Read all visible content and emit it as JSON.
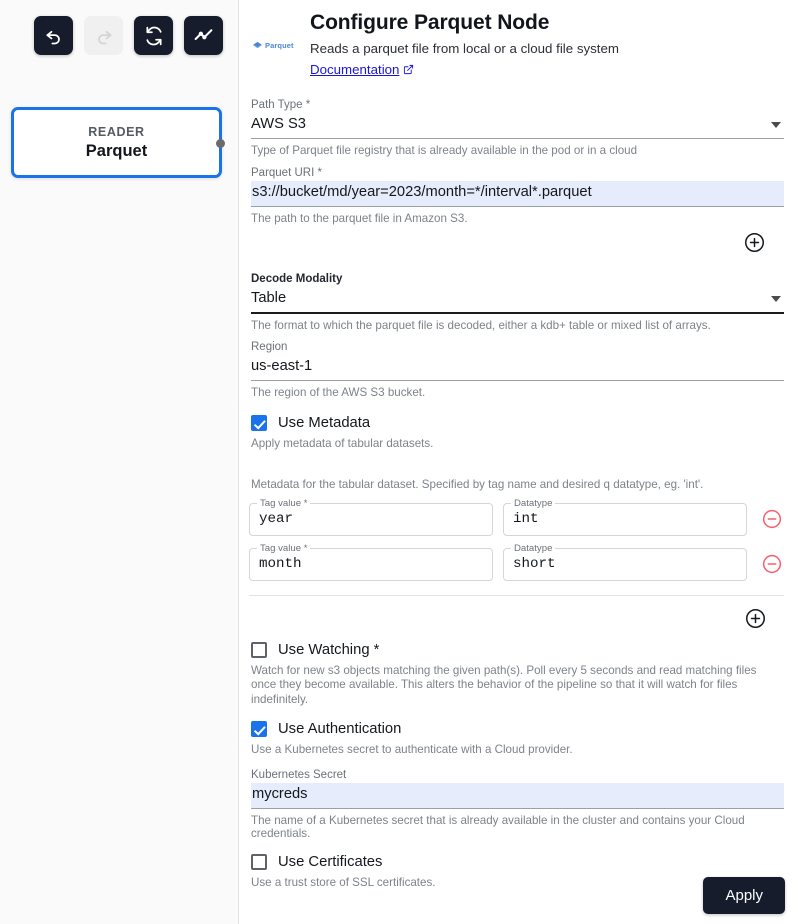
{
  "toolbar": {
    "buttons": [
      {
        "name": "undo",
        "label": "Undo",
        "icon": "undo-icon",
        "enabled": true
      },
      {
        "name": "redo",
        "label": "Redo",
        "icon": "redo-icon",
        "enabled": false
      },
      {
        "name": "refresh",
        "label": "Refresh",
        "icon": "sync-icon",
        "enabled": true
      },
      {
        "name": "activity",
        "label": "Activity",
        "icon": "line-chart-icon",
        "enabled": true
      }
    ]
  },
  "canvas": {
    "node": {
      "kind": "READER",
      "title": "Parquet"
    }
  },
  "header": {
    "logo_text": "Parquet",
    "logo_icon": "parquet-diamond-icon",
    "title": "Configure Parquet Node",
    "description": "Reads a parquet file from local or a cloud file system",
    "link_label": "Documentation",
    "link_icon": "external-link-icon"
  },
  "form": {
    "path_type": {
      "label": "Path Type *",
      "value": "AWS S3",
      "help": "Type of Parquet file registry that is already available in the pod or in a cloud"
    },
    "parquet_uri": {
      "label": "Parquet URI *",
      "value": "s3://bucket/md/year=2023/month=*/interval*.parquet",
      "help": "The path to the parquet file in Amazon S3."
    },
    "add_uri_button": {
      "icon": "plus-circle-icon",
      "label": "Add path"
    },
    "decode_modality": {
      "label": "Decode Modality",
      "value": "Table",
      "help": "The format to which the parquet file is decoded, either a kdb+ table or mixed list of arrays."
    },
    "region": {
      "label": "Region",
      "value": "us-east-1",
      "help": "The region of the AWS S3 bucket."
    },
    "use_metadata": {
      "label": "Use Metadata",
      "checked": true,
      "help": "Apply metadata of tabular datasets."
    },
    "metadata_note": "Metadata for the tabular dataset. Specified by tag name and desired q datatype, eg. 'int'.",
    "metadata_rows": [
      {
        "tag_label": "Tag value *",
        "tag_value": "year",
        "datatype_label": "Datatype",
        "datatype_value": "int",
        "remove_icon": "minus-circle-icon"
      },
      {
        "tag_label": "Tag value *",
        "tag_value": "month",
        "datatype_label": "Datatype",
        "datatype_value": "short",
        "remove_icon": "minus-circle-icon"
      }
    ],
    "add_metadata_button": {
      "icon": "plus-circle-icon",
      "label": "Add metadata row"
    },
    "use_watching": {
      "label": "Use Watching *",
      "checked": false,
      "help": "Watch for new s3 objects matching the given path(s). Poll every 5 seconds and read matching files once they become available. This alters the behavior of the pipeline so that it will watch for files indefinitely."
    },
    "use_authentication": {
      "label": "Use Authentication",
      "checked": true,
      "help": "Use a Kubernetes secret to authenticate with a Cloud provider."
    },
    "kubernetes_secret": {
      "label": "Kubernetes Secret",
      "value": "mycreds",
      "help": "The name of a Kubernetes secret that is already available in the cluster and contains your Cloud credentials."
    },
    "use_certificates": {
      "label": "Use Certificates",
      "checked": false,
      "help": "Use a trust store of SSL certificates."
    },
    "apply_button": "Apply"
  },
  "colors": {
    "accent_blue": "#1a73e8",
    "dark_button": "#161c2b",
    "link_blue": "#1a14d6",
    "remove_red": "#f4606c",
    "highlight_field": "#e6ecfb",
    "canvas_bg": "#fafafa"
  }
}
